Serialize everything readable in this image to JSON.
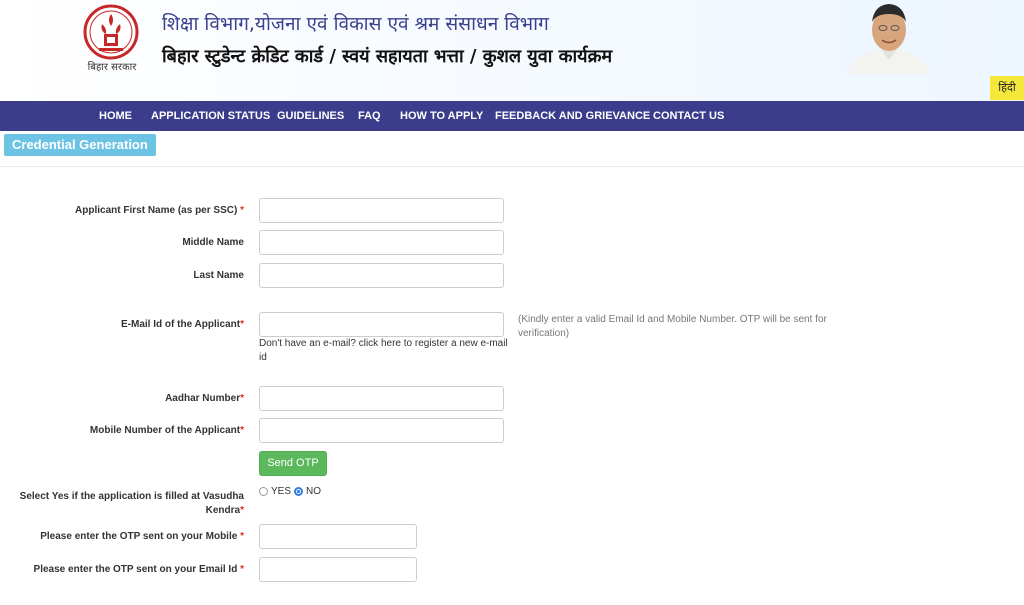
{
  "header": {
    "emblem_caption": "बिहार सरकार",
    "title_line1": "शिक्षा विभाग,योजना एवं विकास एवं श्रम संसाधन विभाग",
    "title_line2": "बिहार स्टुडेन्ट क्रेडिट कार्ड / स्वयं सहायता भत्ता / कुशल युवा कार्यक्रम",
    "language_toggle": "हिंदी"
  },
  "nav": {
    "items": [
      "HOME",
      "APPLICATION STATUS",
      "GUIDELINES",
      "FAQ",
      "HOW TO APPLY",
      "FEEDBACK AND GRIEVANCE",
      "CONTACT US"
    ]
  },
  "section": {
    "title": "Credential Generation"
  },
  "form": {
    "first_name_label": "Applicant First Name (as per SSC)",
    "middle_name_label": "Middle Name",
    "last_name_label": "Last Name",
    "email_label": "E-Mail Id of the Applicant",
    "email_help": "Don't have an e-mail? click here to register a new e-mail id",
    "email_note": "(Kindly enter a valid Email Id and Mobile Number. OTP will be sent for verification)",
    "aadhar_label": "Aadhar Number",
    "mobile_label": "Mobile Number of the Applicant",
    "send_otp": "Send OTP",
    "vasudha_label_line1": "Select Yes if the application is filled at Vasudha",
    "vasudha_label_line2": "Kendra",
    "vasudha_yes": "YES",
    "vasudha_no": "NO",
    "vasudha_selected": "NO",
    "otp_mobile_label": "Please enter the OTP sent on your Mobile",
    "otp_email_label": "Please enter the OTP sent on your Email Id",
    "required_mark": "*"
  },
  "colors": {
    "nav_bg": "#3b3d8c",
    "badge_bg": "#6cc3e4",
    "otp_button": "#5cb85c",
    "required": "#d9322a",
    "lang_toggle_bg": "#f5e83a"
  },
  "icons": [
    "bihar-emblem-icon",
    "chief-minister-portrait"
  ]
}
